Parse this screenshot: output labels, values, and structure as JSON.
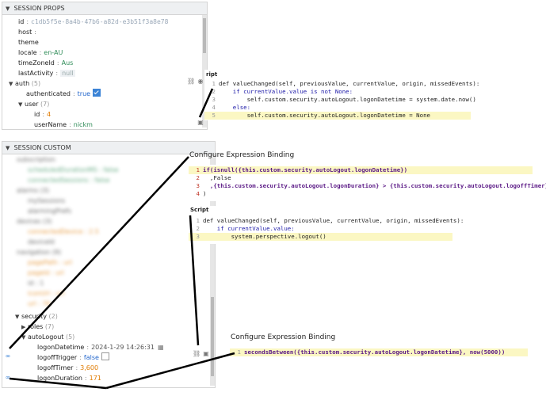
{
  "session_props": {
    "title": "SESSION PROPS",
    "id_key": "id",
    "id_val": "c1db5f5e-8a4b-47b6-a82d-e3b51f3a8e78",
    "host_key": "host",
    "theme_key": "theme",
    "locale_key": "locale",
    "locale_val": "en-AU",
    "tz_key": "timeZoneId",
    "tz_val": "Aus",
    "last_key": "lastActivity",
    "last_val": "null",
    "auth_key": "auth",
    "auth_count": "(5)",
    "authenticated_key": "authenticated",
    "authenticated_val": "true",
    "user_key": "user",
    "user_count": "(7)",
    "uid_key": "id",
    "uid_val": "4",
    "uname_key": "userName",
    "uname_val": "nickm"
  },
  "script_top": {
    "label": "ript",
    "lines": [
      {
        "n": "1",
        "t": "def valueChanged(self, previousValue, currentValue, origin, missedEvents):"
      },
      {
        "n": "2",
        "t": "    if currentValue.value is not None:"
      },
      {
        "n": "3",
        "t": "        self.custom.security.autoLogout.logonDatetime = system.date.now()"
      },
      {
        "n": "4",
        "t": "    else:"
      },
      {
        "n": "5",
        "t": "        self.custom.security.autoLogout.logonDatetime = None"
      }
    ]
  },
  "session_custom": {
    "title": "SESSION CUSTOM",
    "blurred": [
      "subscription",
      "scheduledDurationMS : false",
      "connectedSessions : false",
      "alarms (3)",
      "mySessions",
      "alarmingPrefs",
      "devices (3)",
      "connectedDevice : 2.5",
      "deviceId",
      "navigation (9)",
      "pagePath : url",
      "pageId : url",
      "id : 1",
      "iconUrl : url",
      "url : 76"
    ],
    "security_key": "security",
    "security_count": "(2)",
    "roles_key": "roles",
    "roles_count": "(7)",
    "autologout_key": "autoLogout",
    "autologout_count": "(5)",
    "logon_dt_key": "logonDatetime",
    "logon_dt_val": "2024-1-29 14:26:31",
    "logoff_trigger_key": "logoffTrigger",
    "logoff_trigger_val": "false",
    "logoff_timer_key": "logoffTimer",
    "logoff_timer_val": "3,600",
    "logon_dur_key": "logonDuration",
    "logon_dur_val": "171"
  },
  "expr1": {
    "title": "Configure Expression Binding",
    "lines": [
      {
        "n": "1",
        "t": "if(isnull({this.custom.security.autoLogout.logonDatetime})"
      },
      {
        "n": "2",
        "t": "  ,False"
      },
      {
        "n": "3",
        "t": "  ,{this.custom.security.autoLogout.logonDuration} > {this.custom.security.autoLogout.logoffTimer}"
      },
      {
        "n": "4",
        "t": ")"
      }
    ]
  },
  "script2": {
    "label": "Script",
    "lines": [
      {
        "n": "1",
        "t": "def valueChanged(self, previousValue, currentValue, origin, missedEvents):"
      },
      {
        "n": "2",
        "t": "    if currentValue.value:"
      },
      {
        "n": "3",
        "t": "        system.perspective.logout()"
      }
    ]
  },
  "expr2": {
    "title": "Configure Expression Binding",
    "lines": [
      {
        "n": "1",
        "t": "secondsBetween({this.custom.security.autoLogout.logonDatetime}, now(5000))"
      }
    ]
  },
  "colors": {
    "accent": "#3b83d6",
    "highlight": "#fbf7c3",
    "string": "#2e8b57",
    "number": "#e07b00"
  }
}
